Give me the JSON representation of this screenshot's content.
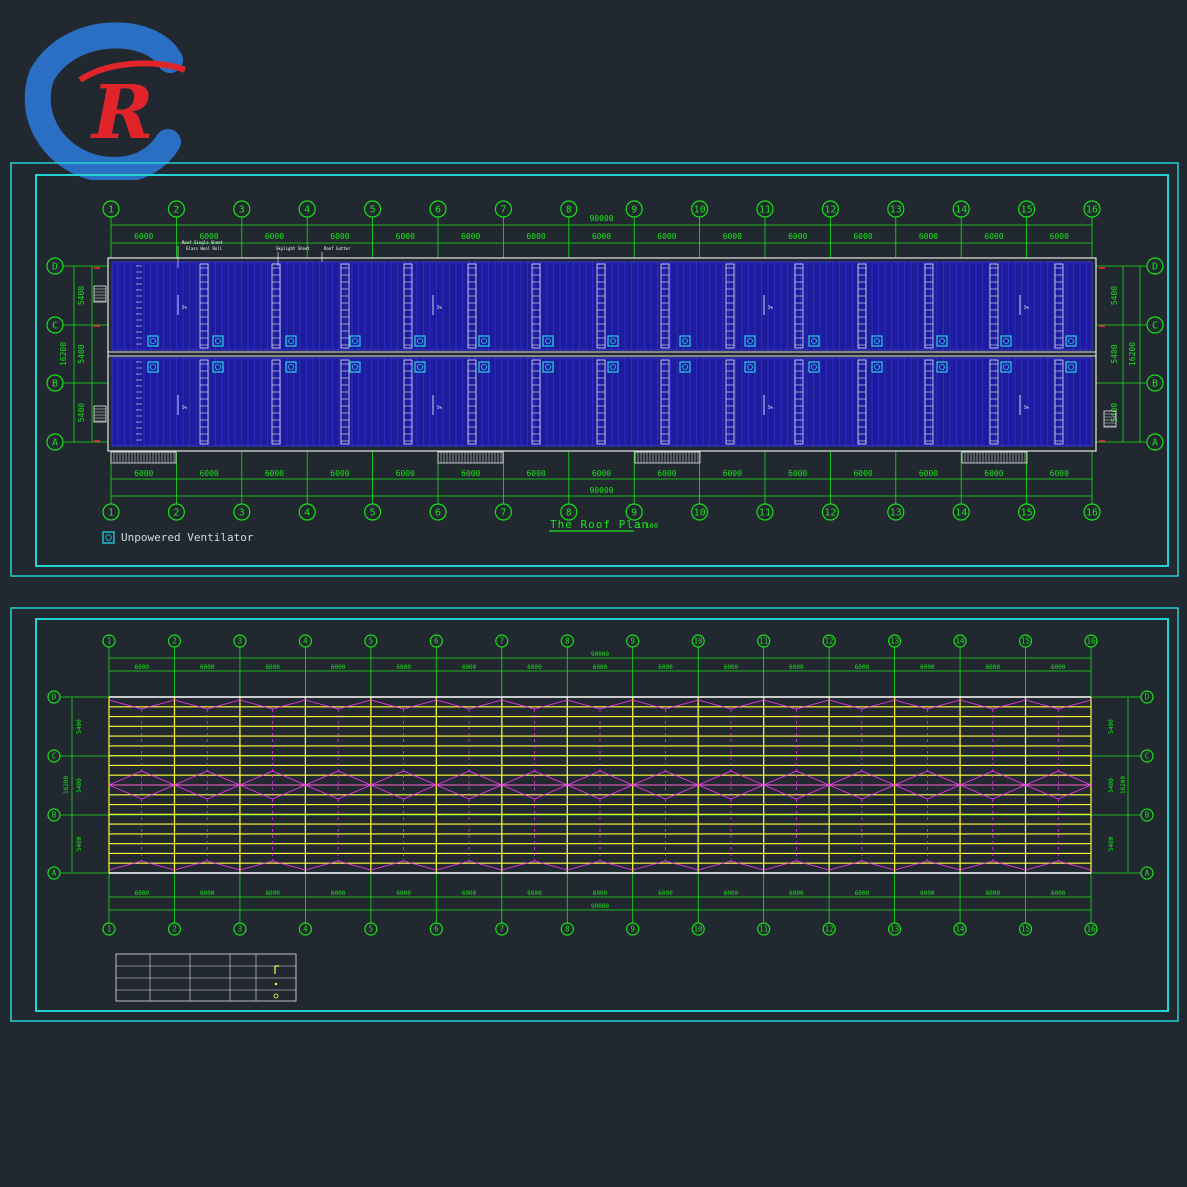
{
  "logo": {
    "letter": "R",
    "ring_color": "#2a6fc4",
    "letter_color": "#e0242a"
  },
  "colors": {
    "background": "#212830",
    "frame": "#22d3d3",
    "dimension": "#18e318",
    "roof_panel": "#1c1c9c",
    "panel_stroke": "#3535d8",
    "truss": "#ff33ff",
    "purlin": "#ffff3a",
    "ventilator": "#25d0e8",
    "red_mark": "#ff2a2a"
  },
  "grid": {
    "columns": [
      "1",
      "2",
      "3",
      "4",
      "5",
      "6",
      "7",
      "8",
      "9",
      "10",
      "11",
      "12",
      "13",
      "14",
      "15",
      "16"
    ],
    "rows": [
      "D",
      "C",
      "B",
      "A"
    ]
  },
  "roof_plan": {
    "top_spans": [
      "6000",
      "6000",
      "6000",
      "6000",
      "6000",
      "6000",
      "6000",
      "6000",
      "6000",
      "6000",
      "6000",
      "6000",
      "6000",
      "6000",
      "6000"
    ],
    "bottom_spans": [
      "6000",
      "6000",
      "6000",
      "6000",
      "6000",
      "6000",
      "6000",
      "6000",
      "6000",
      "6000",
      "6000",
      "6000",
      "6000",
      "6000",
      "6000"
    ],
    "total_length": "90000",
    "row_spans": [
      "5400",
      "5400",
      "5400"
    ],
    "total_width": "16200",
    "title": "The Roof Plan",
    "scale": "1:100",
    "legend_label": "Unpowered Ventilator",
    "notes": [
      "Roof Single Sheet",
      "Glass Wool Roll",
      "Skylight Sheet",
      "Roof Gutter"
    ],
    "slope_label": "5%"
  },
  "frame_plan": {
    "top_spans": [
      "6000",
      "6000",
      "6000",
      "6000",
      "6000",
      "6000",
      "6000",
      "6000",
      "6000",
      "6000",
      "6000",
      "6000",
      "6000",
      "6000",
      "6000"
    ],
    "bottom_spans": [
      "6000",
      "6000",
      "6000",
      "6000",
      "6000",
      "6000",
      "6000",
      "6000",
      "6000",
      "6000",
      "6000",
      "6000",
      "6000",
      "6000",
      "6000"
    ],
    "total_length": "90000",
    "row_spans": [
      "5400",
      "5400",
      "5400"
    ],
    "total_width": "16200"
  }
}
